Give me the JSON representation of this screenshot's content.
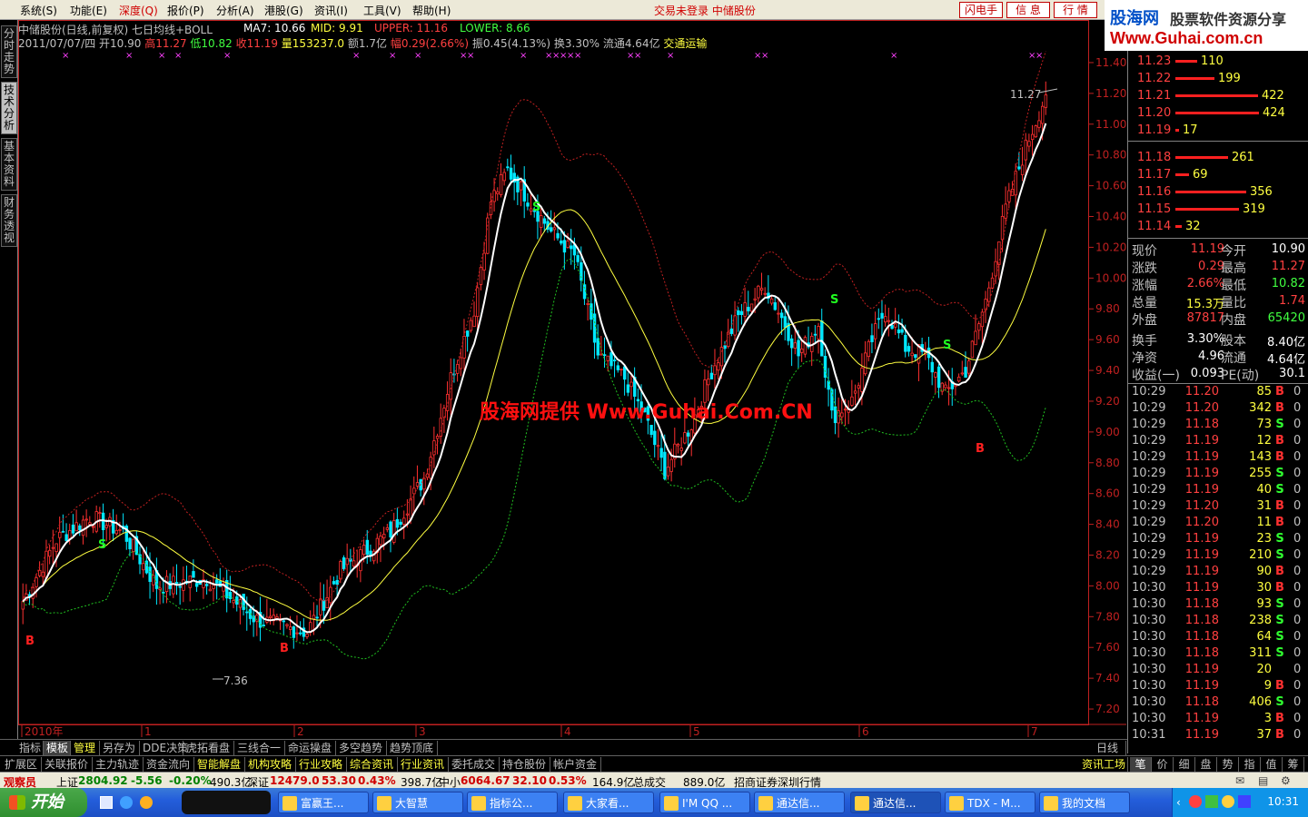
{
  "menu": {
    "items": [
      "系统(S)",
      "功能(E)",
      "深度(Q)",
      "报价(P)",
      "分析(A)",
      "港股(G)",
      "资讯(I)",
      "工具(V)",
      "帮助(H)"
    ],
    "active_index": 2,
    "status": "交易未登录  中储股份",
    "buttons": [
      "闪电手",
      "信 息",
      "行 情"
    ]
  },
  "logo": {
    "name": "股海网",
    "slogan": "股票软件资源分享",
    "url": "Www.Guhai.com.cn"
  },
  "left_tabs": [
    "分时走势",
    "技术分析",
    "基本资料",
    "财务透视"
  ],
  "left_tab_active": 1,
  "chart": {
    "header": {
      "name": "中储股份(日线,前复权) 七日均线+BOLL",
      "ma7": "MA7: 10.66",
      "mid": "MID: 9.91",
      "upper": "UPPER: 11.16",
      "lower": "LOWER: 8.66",
      "date": "2011/07/07/四",
      "open": "开10.90",
      "high": "高11.27",
      "low": "低10.82",
      "close": "收11.19",
      "volume": "量153237.0",
      "amount": "额1.7亿",
      "change": "幅0.29(2.66%)",
      "amplitude": "振0.45(4.13%)",
      "turnover": "换3.30%",
      "float": "流通4.64亿",
      "industry": "交通运输"
    },
    "watermark": "股海网提供 Www.Guhai.Com.CN",
    "high_label": "11.27",
    "low_label": "7.36",
    "x_labels": [
      "2010年",
      "1",
      "2",
      "3",
      "4",
      "5",
      "6",
      "7"
    ],
    "x_period": "日线",
    "y_ticks": [
      "11.40",
      "11.20",
      "11.00",
      "10.80",
      "10.60",
      "10.40",
      "10.20",
      "10.00",
      "9.80",
      "9.60",
      "9.40",
      "9.20",
      "9.00",
      "8.80",
      "8.60",
      "8.40",
      "8.20",
      "8.00",
      "7.80",
      "7.60",
      "7.40",
      "7.20"
    ],
    "colors": {
      "up": "#ff3030",
      "down": "#00e8ff",
      "ma": "#ffffff",
      "mid": "#ffff40",
      "upper": "#c02020",
      "lower": "#20c020"
    },
    "signals": [
      {
        "label": "B",
        "color": "#ff2020"
      },
      {
        "label": "S",
        "color": "#20ff20"
      },
      {
        "label": "B",
        "color": "#ff2020"
      },
      {
        "label": "S",
        "color": "#20ff20"
      },
      {
        "label": "S",
        "color": "#20ff20"
      },
      {
        "label": "S",
        "color": "#20ff20"
      },
      {
        "label": "B",
        "color": "#ff2020"
      }
    ]
  },
  "orderbook": [
    {
      "price": "11.23",
      "vol": "110",
      "share": 0.25
    },
    {
      "price": "11.22",
      "vol": "199",
      "share": 0.45
    },
    {
      "price": "11.21",
      "vol": "422",
      "share": 0.95
    },
    {
      "price": "11.20",
      "vol": "424",
      "share": 0.96
    },
    {
      "price": "11.19",
      "vol": "17",
      "share": 0.04
    },
    {
      "price": "11.18",
      "vol": "261",
      "share": 0.6
    },
    {
      "price": "11.17",
      "vol": "69",
      "share": 0.16
    },
    {
      "price": "11.16",
      "vol": "356",
      "share": 0.81
    },
    {
      "price": "11.15",
      "vol": "319",
      "share": 0.73
    },
    {
      "price": "11.14",
      "vol": "32",
      "share": 0.07
    }
  ],
  "quote": [
    {
      "l1": "现价",
      "v1": "11.19",
      "c1": "#ff4040",
      "l2": "今开",
      "v2": "10.90",
      "c2": "#ffffff"
    },
    {
      "l1": "涨跌",
      "v1": "0.29",
      "c1": "#ff4040",
      "l2": "最高",
      "v2": "11.27",
      "c2": "#ff4040"
    },
    {
      "l1": "涨幅",
      "v1": "2.66%",
      "c1": "#ff4040",
      "l2": "最低",
      "v2": "10.82",
      "c2": "#40ff40"
    },
    {
      "l1": "总量",
      "v1": "15.3万",
      "c1": "#ffff40",
      "l2": "量比",
      "v2": "1.74",
      "c2": "#ff4040"
    },
    {
      "l1": "外盘",
      "v1": "87817",
      "c1": "#ff4040",
      "l2": "内盘",
      "v2": "65420",
      "c2": "#40ff40"
    },
    {
      "l1": "换手",
      "v1": "3.30%",
      "c1": "#ffffff",
      "l2": "股本",
      "v2": "8.40亿",
      "c2": "#ffffff"
    },
    {
      "l1": "净资",
      "v1": "4.96",
      "c1": "#ffffff",
      "l2": "流通",
      "v2": "4.64亿",
      "c2": "#ffffff"
    },
    {
      "l1": "收益(一)",
      "v1": "0.093",
      "c1": "#ffffff",
      "l2": "PE(动)",
      "v2": "30.1",
      "c2": "#ffffff"
    }
  ],
  "ticks": [
    {
      "time": "10:29",
      "price": "11.20",
      "vol": "85",
      "dir": "B",
      "n": "0"
    },
    {
      "time": "10:29",
      "price": "11.20",
      "vol": "342",
      "dir": "B",
      "n": "0"
    },
    {
      "time": "10:29",
      "price": "11.18",
      "vol": "73",
      "dir": "S",
      "n": "0"
    },
    {
      "time": "10:29",
      "price": "11.19",
      "vol": "12",
      "dir": "B",
      "n": "0"
    },
    {
      "time": "10:29",
      "price": "11.19",
      "vol": "143",
      "dir": "B",
      "n": "0"
    },
    {
      "time": "10:29",
      "price": "11.19",
      "vol": "255",
      "dir": "S",
      "n": "0"
    },
    {
      "time": "10:29",
      "price": "11.19",
      "vol": "40",
      "dir": "S",
      "n": "0"
    },
    {
      "time": "10:29",
      "price": "11.20",
      "vol": "31",
      "dir": "B",
      "n": "0"
    },
    {
      "time": "10:29",
      "price": "11.20",
      "vol": "11",
      "dir": "B",
      "n": "0"
    },
    {
      "time": "10:29",
      "price": "11.19",
      "vol": "23",
      "dir": "S",
      "n": "0"
    },
    {
      "time": "10:29",
      "price": "11.19",
      "vol": "210",
      "dir": "S",
      "n": "0"
    },
    {
      "time": "10:29",
      "price": "11.19",
      "vol": "90",
      "dir": "B",
      "n": "0"
    },
    {
      "time": "10:30",
      "price": "11.19",
      "vol": "30",
      "dir": "B",
      "n": "0"
    },
    {
      "time": "10:30",
      "price": "11.18",
      "vol": "93",
      "dir": "S",
      "n": "0"
    },
    {
      "time": "10:30",
      "price": "11.18",
      "vol": "238",
      "dir": "S",
      "n": "0"
    },
    {
      "time": "10:30",
      "price": "11.18",
      "vol": "64",
      "dir": "S",
      "n": "0"
    },
    {
      "time": "10:30",
      "price": "11.18",
      "vol": "311",
      "dir": "S",
      "n": "0"
    },
    {
      "time": "10:30",
      "price": "11.19",
      "vol": "20",
      "dir": "",
      "n": "0"
    },
    {
      "time": "10:30",
      "price": "11.19",
      "vol": "9",
      "dir": "B",
      "n": "0"
    },
    {
      "time": "10:30",
      "price": "11.18",
      "vol": "406",
      "dir": "S",
      "n": "0"
    },
    {
      "time": "10:30",
      "price": "11.19",
      "vol": "3",
      "dir": "B",
      "n": "0"
    },
    {
      "time": "10:31",
      "price": "11.19",
      "vol": "37",
      "dir": "B",
      "n": "0"
    }
  ],
  "tabs1": [
    "指标",
    "模板",
    "管理",
    "另存为",
    "DDE决策",
    "虎拓看盘",
    "三线合一",
    "命运操盘",
    "多空趋势",
    "趋势顶底"
  ],
  "tabs1_active": 1,
  "tabs2": [
    "扩展区",
    "关联报价",
    "主力轨迹",
    "资金流向",
    "智能解盘",
    "机构攻略",
    "行业攻略",
    "综合资讯",
    "行业资讯",
    "委托成交",
    "持仓股份",
    "帐户资金"
  ],
  "tabs2_right": "资讯工场",
  "right_tabs": [
    "笔",
    "价",
    "细",
    "盘",
    "势",
    "指",
    "值",
    "筹"
  ],
  "index_bar": {
    "label": "观察员",
    "sh_name": "上证",
    "sh_val": "2804.92",
    "sh_chg": "-5.56",
    "sh_pct": "-0.20%",
    "sh_amt": "490.3亿",
    "sz_name": "深证",
    "sz_val": "12479.0",
    "sz_chg": "53.30",
    "sz_pct": "0.43%",
    "sz_amt": "398.7亿",
    "zx_name": "中小",
    "zx_val": "6064.67",
    "zx_chg": "32.10",
    "zx_pct": "0.53%",
    "zx_amt": "164.9亿",
    "total": "总成交",
    "total_amt": "889.0亿",
    "broker": "招商证券深圳行情"
  },
  "taskbar": {
    "start": "开始",
    "tasks": [
      "富赢王...",
      "大智慧",
      "指标公...",
      "大家看...",
      "I'M QQ ...",
      "通达信...",
      "通达信...",
      "TDX - M...",
      "我的文档"
    ],
    "active_task": 6,
    "clock": "10:31"
  }
}
